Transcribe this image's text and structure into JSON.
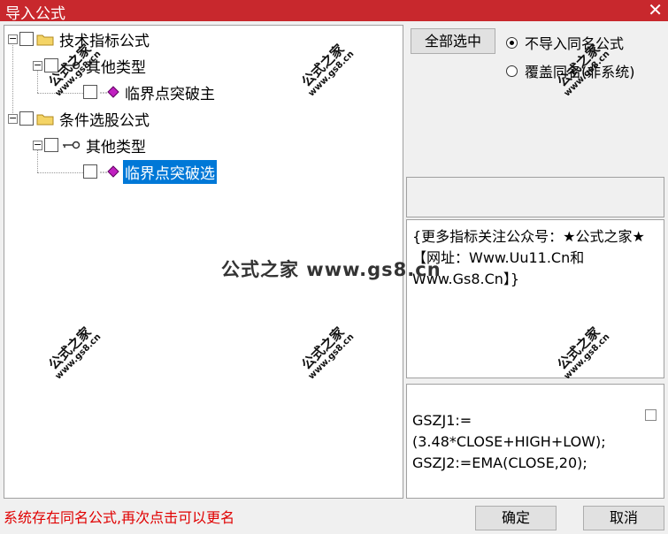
{
  "window": {
    "title": "导入公式",
    "close_glyph": "✕"
  },
  "tree": {
    "nodes": [
      {
        "label": "技术指标公式"
      },
      {
        "label": "其他类型"
      },
      {
        "label": "临界点突破主"
      },
      {
        "label": "条件选股公式"
      },
      {
        "label": "其他类型"
      },
      {
        "label": "临界点突破选",
        "selected": true
      }
    ]
  },
  "buttons": {
    "select_all": "全部选中",
    "ok": "确定",
    "cancel": "取消"
  },
  "options": {
    "no_import_same_name": {
      "label": "不导入同名公式",
      "checked": true
    },
    "overwrite_same_name": {
      "label": "覆盖同名(非系统)",
      "checked": false
    }
  },
  "description": "{更多指标关注公众号：★公式之家★【网址：Www.Uu11.Cn和Www.Gs8.Cn】}",
  "code_lines": [
    "GSZJ1:=(3.48*CLOSE+HIGH+LOW);",
    "GSZJ2:=EMA(CLOSE,20);"
  ],
  "status_message": "系统存在同名公式,再次点击可以更名",
  "watermark": {
    "main": "公式之家",
    "url": "www.gs8.cn",
    "center": "公式之家 www.gs8.cn"
  },
  "colors": {
    "titlebar": "#c8282d",
    "selection": "#0078d7",
    "status_text": "#e00000"
  },
  "icons": {
    "folder": "folder-icon",
    "formula_type": "key-icon",
    "formula": "gem-icon"
  }
}
